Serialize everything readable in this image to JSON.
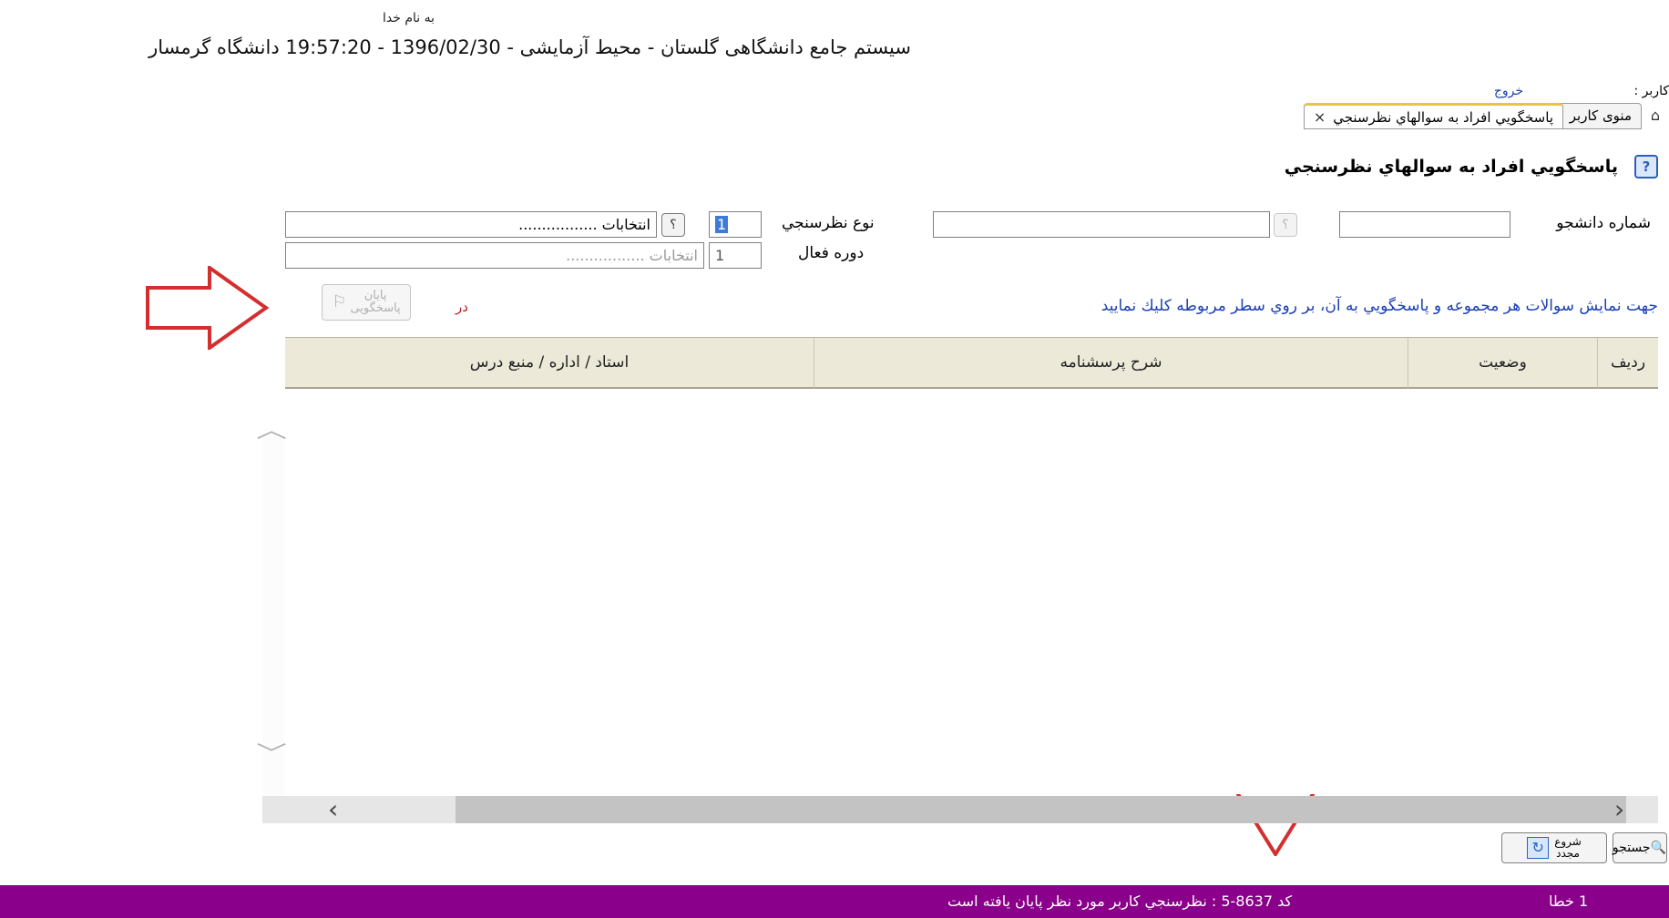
{
  "header": {
    "bismillah": "به نام خدا",
    "system_line": "سیستم جامع دانشگاهی گلستان - محیط آزمایشی - 1396/02/30 - 19:57:20   دانشگاه گرمسار",
    "user_label": "کاربر :",
    "exit_label": "خروج"
  },
  "tabs": [
    {
      "label": "منوی کاربر",
      "close": "×"
    },
    {
      "label": "پاسخگويي افراد به سوالهاي نظرسنجي",
      "close": "×"
    }
  ],
  "page": {
    "title": "پاسخگويي افراد به سوالهاي نظرسنجي",
    "help_glyph": "?"
  },
  "form": {
    "student_number_label": "شماره دانشجو",
    "student_number_value": "",
    "student_help": "؟",
    "student_name_value": "",
    "survey_type_label": "نوع نظرسنجي",
    "survey_type_value": "1",
    "survey_help": "؟",
    "survey_select_value": "انتخابات .................",
    "active_term_label": "دوره فعال",
    "active_term_value": "1",
    "active_term_select_value": "انتخابات ................."
  },
  "instruction": "جهت نمايش سوالات هر مجموعه و پاسخگويي به آن، بر روي سطر مربوطه كليك نماييد",
  "dar": "در",
  "finish_button": {
    "line1": "پایان",
    "line2": "پاسخگویی"
  },
  "table": {
    "headers": {
      "row": "رديف",
      "status": "وضعيت",
      "description": "شرح پرسشنامه",
      "teacher": "استاد / اداره / منبع درس"
    }
  },
  "buttons": {
    "search": "جستجو",
    "restart_line1": "شروع",
    "restart_line2": "مجدد"
  },
  "status_bar": {
    "message": "کد 8637-5 : نظرسنجي کاربر مورد نظر پایان یافته است",
    "errors": "1 خطا"
  },
  "colors": {
    "status_bar": "#8a008a",
    "link": "#1a3fb3",
    "annotation_arrows": "#d32f2f",
    "grid_header": "#ece9d8",
    "active_tab_accent": "#e9c24a"
  }
}
